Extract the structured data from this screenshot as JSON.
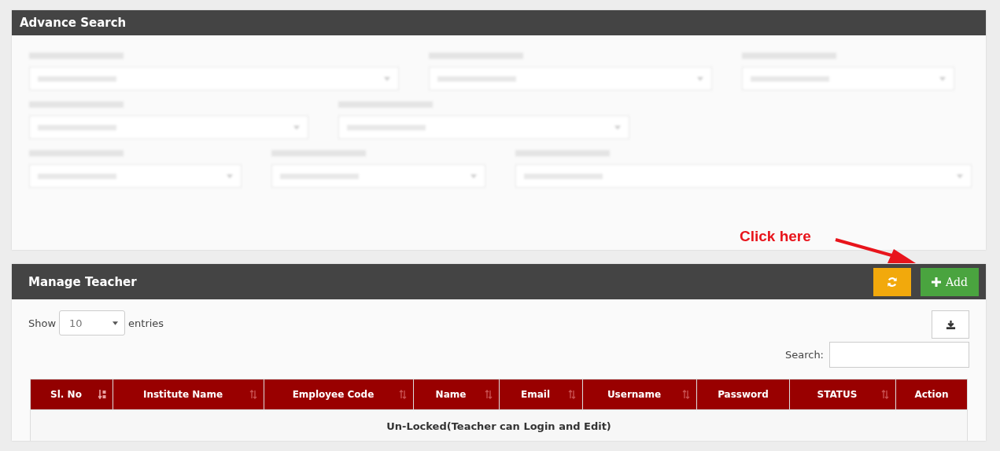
{
  "advance_search": {
    "title": "Advance Search"
  },
  "annotation": {
    "text": "Click here"
  },
  "manage": {
    "title": "Manage Teacher",
    "add_button": "Add",
    "length": {
      "before": "Show",
      "value": "10",
      "after": "entries"
    },
    "search_label": "Search:",
    "table": {
      "columns": [
        {
          "label": "Sl. No",
          "sortable": true,
          "sorted": true
        },
        {
          "label": "Institute Name",
          "sortable": true,
          "sorted": false
        },
        {
          "label": "Employee Code",
          "sortable": true,
          "sorted": false
        },
        {
          "label": "Name",
          "sortable": true,
          "sorted": false
        },
        {
          "label": "Email",
          "sortable": true,
          "sorted": false
        },
        {
          "label": "Username",
          "sortable": true,
          "sorted": false
        },
        {
          "label": "Password",
          "sortable": false,
          "sorted": false
        },
        {
          "label": "STATUS",
          "sortable": true,
          "sorted": false
        },
        {
          "label": "Action",
          "sortable": false,
          "sorted": false
        }
      ],
      "group_row": "Un-Locked(Teacher can Login and Edit)"
    }
  }
}
